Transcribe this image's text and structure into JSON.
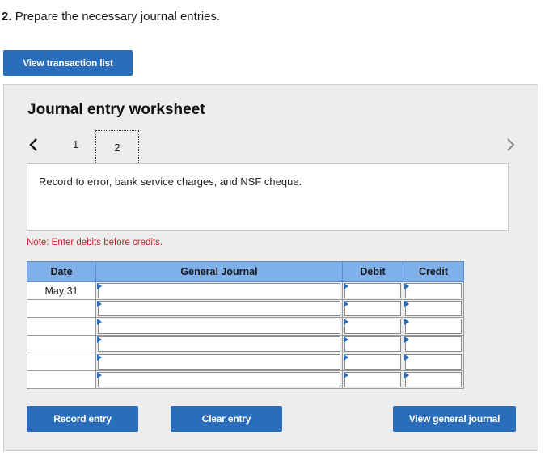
{
  "question": {
    "number": "2.",
    "text": "Prepare the necessary journal entries."
  },
  "buttons": {
    "view_transaction_list": "View transaction list",
    "record_entry": "Record entry",
    "clear_entry": "Clear entry",
    "view_general_journal": "View general journal"
  },
  "worksheet": {
    "title": "Journal entry worksheet",
    "pages": [
      "1",
      "2"
    ],
    "current_page": "2",
    "description": "Record to error, bank service charges, and NSF cheque.",
    "note": "Note: Enter debits before credits."
  },
  "table": {
    "headers": {
      "date": "Date",
      "general_journal": "General Journal",
      "debit": "Debit",
      "credit": "Credit"
    },
    "rows": [
      {
        "date": "May 31",
        "account": "",
        "debit": "",
        "credit": ""
      },
      {
        "date": "",
        "account": "",
        "debit": "",
        "credit": ""
      },
      {
        "date": "",
        "account": "",
        "debit": "",
        "credit": ""
      },
      {
        "date": "",
        "account": "",
        "debit": "",
        "credit": ""
      },
      {
        "date": "",
        "account": "",
        "debit": "",
        "credit": ""
      },
      {
        "date": "",
        "account": "",
        "debit": "",
        "credit": ""
      }
    ]
  },
  "colors": {
    "button_blue": "#2a6ebb",
    "header_blue": "#7fb0ea",
    "note_red": "#c0282d",
    "panel_gray": "#ededed"
  },
  "icons": {
    "prev": "chevron-left-icon",
    "next": "chevron-right-icon",
    "dropdown": "dropdown-triangle-icon"
  }
}
